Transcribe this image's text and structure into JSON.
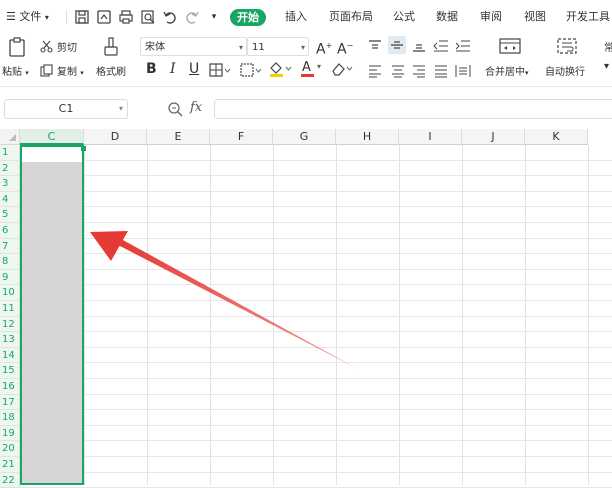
{
  "menubar": {
    "file_label": "文件",
    "tabs": [
      {
        "label": "开始",
        "active": true
      },
      {
        "label": "插入"
      },
      {
        "label": "页面布局"
      },
      {
        "label": "公式"
      },
      {
        "label": "数据"
      },
      {
        "label": "审阅"
      },
      {
        "label": "视图"
      },
      {
        "label": "开发工具"
      }
    ]
  },
  "ribbon": {
    "paste_label": "粘贴",
    "cut_label": "剪切",
    "copy_label": "复制",
    "format_painter_label": "格式刷",
    "font_name": "宋体",
    "font_size": "11",
    "merge_center_label": "合并居中",
    "wrap_text_label": "自动换行",
    "bold": "B",
    "italic": "I",
    "underline": "U",
    "grow": "A",
    "shrink": "A",
    "font_color_glyph": "A",
    "overflow_char": "常"
  },
  "formula_bar": {
    "name_box": "C1",
    "fx": "fx",
    "value": ""
  },
  "sheet": {
    "columns": [
      "C",
      "D",
      "E",
      "F",
      "G",
      "H",
      "I",
      "J",
      "K"
    ],
    "rows": [
      "1",
      "2",
      "3",
      "4",
      "5",
      "6",
      "7",
      "8",
      "9",
      "10",
      "11",
      "12",
      "13",
      "14",
      "15",
      "16",
      "17",
      "18",
      "19",
      "20",
      "21",
      "22"
    ]
  },
  "colors": {
    "accent": "#1aa567",
    "annotation_arrow": "#e53935",
    "selected_fill": "#d6d6d6"
  }
}
